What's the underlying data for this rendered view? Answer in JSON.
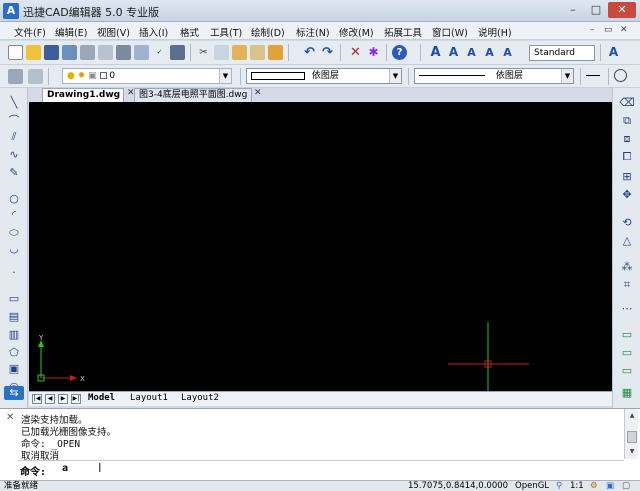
{
  "window": {
    "title": "迅捷CAD编辑器 5.0 专业版",
    "app_icon_letter": "A",
    "minimize_glyph": "–",
    "maximize_glyph": "□",
    "close_glyph": "✕"
  },
  "menu": {
    "items": [
      "文件(F)",
      "编辑(E)",
      "视图(V)",
      "插入(I)",
      "格式",
      "工具(T)",
      "绘制(D)",
      "标注(N)",
      "修改(M)",
      "拓展工具",
      "窗口(W)",
      "说明(H)"
    ],
    "mdi_minimize": "–",
    "mdi_restore": "▭",
    "mdi_close": "✕"
  },
  "toolbar1": {
    "text_style_combo": "Standard"
  },
  "toolbar2": {
    "layer_combo": "0",
    "color_combo": "依图层",
    "linetype_combo": "依图层"
  },
  "doc_tabs": [
    {
      "label": "Drawing1.dwg",
      "active": true
    },
    {
      "label": "图3-4底层电照平面图.dwg",
      "active": false
    }
  ],
  "doc_tab_close": "✕",
  "canvas": {
    "ucs_y_label": "Y",
    "ucs_x_label": "X",
    "background": "#000000",
    "axis_color": "#2bc42b",
    "crosshair_color": "#c41e1e"
  },
  "layout_tabs": {
    "nav": [
      "|◀",
      "◀",
      "▶",
      "▶|"
    ],
    "tabs": [
      "Model",
      "Layout1",
      "Layout2"
    ]
  },
  "command": {
    "history": [
      "渲染支持加载。",
      "已加载光栅图像支持。",
      "命令:  _OPEN",
      "取消取消"
    ],
    "prompt": "命令:",
    "input_value": "a",
    "close_glyph": "✕"
  },
  "status": {
    "ready_text": "准备就绪",
    "coordinates": "15.7075,0.8414,0.0000",
    "renderer": "OpenGL",
    "scale": "1:1"
  }
}
